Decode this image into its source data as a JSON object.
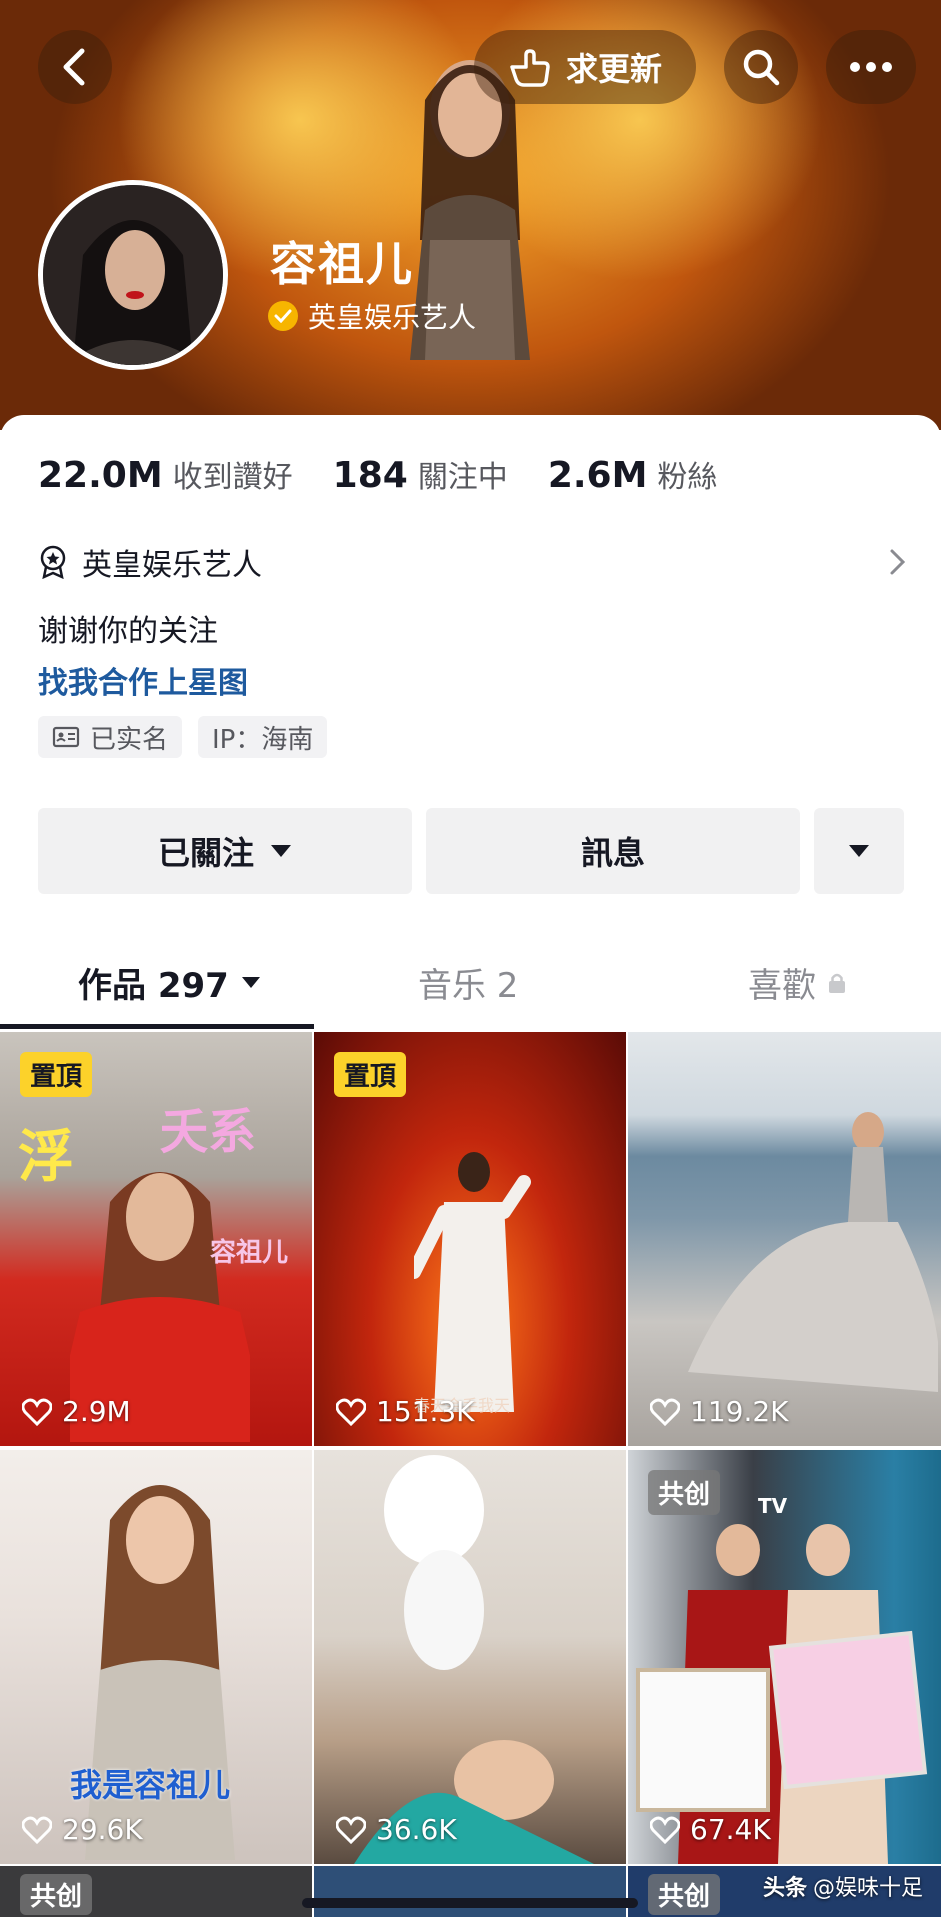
{
  "header": {
    "update_label": "求更新",
    "name": "容祖儿",
    "verification": "英皇娱乐艺人"
  },
  "stats": [
    {
      "value": "22.0M",
      "label": "收到讚好"
    },
    {
      "value": "184",
      "label": "關注中"
    },
    {
      "value": "2.6M",
      "label": "粉絲"
    }
  ],
  "profile": {
    "certification": "英皇娱乐艺人",
    "bio": "谢谢你的关注",
    "collab_link": "找我合作上星图",
    "tags": [
      {
        "icon": "id-card-icon",
        "label": "已实名"
      },
      {
        "label": "IP：海南"
      }
    ]
  },
  "actions": {
    "follow_label": "已關注",
    "message_label": "訊息"
  },
  "tabs": {
    "works": "作品 297",
    "music": "音乐 2",
    "likes": "喜歡"
  },
  "videos": [
    {
      "badge": "置頂",
      "likes": "2.9M",
      "overlay_1": "浮",
      "overlay_2": "夭系",
      "overlay_3": "容祖儿"
    },
    {
      "badge": "置頂",
      "likes": "151.3K",
      "overlay_1": "春天会手我天"
    },
    {
      "likes": "119.2K"
    },
    {
      "likes": "29.6K",
      "overlay_1": "我是容祖儿"
    },
    {
      "likes": "36.6K"
    },
    {
      "badge": "共创",
      "likes": "67.4K",
      "overlay_1": "TV"
    }
  ],
  "partial_row": [
    {
      "badge": "共创"
    },
    {},
    {
      "badge": "共创"
    }
  ],
  "watermark": {
    "brand": "头条",
    "account": "@娱味十足"
  },
  "colors": {
    "link": "#1e5a9e",
    "pin_badge": "#fcd22a",
    "verify_badge": "#f7b500"
  }
}
